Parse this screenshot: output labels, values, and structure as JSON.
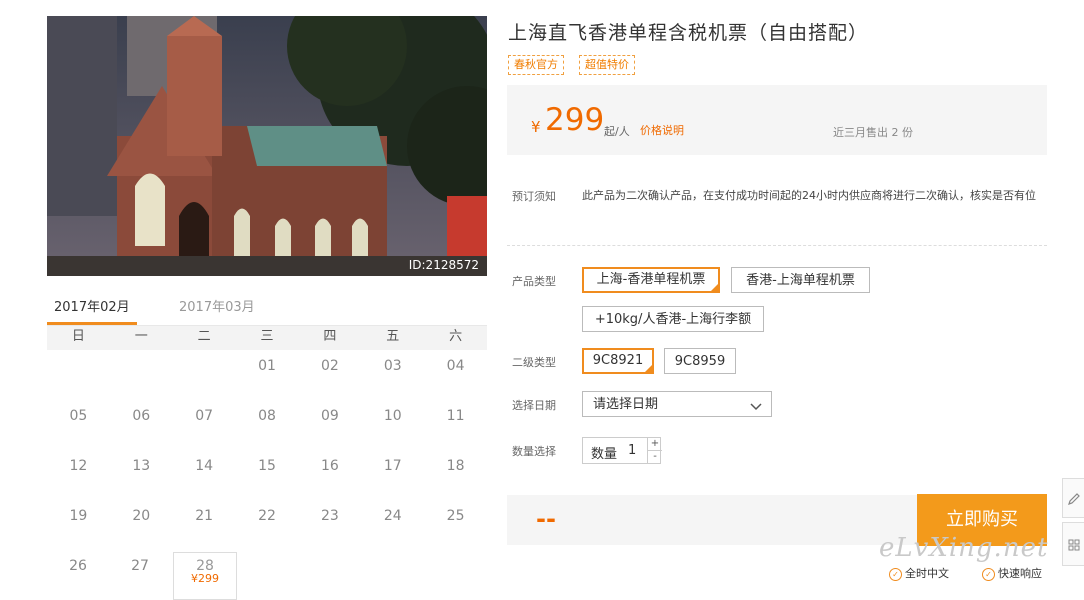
{
  "product": {
    "title": "上海直飞香港单程含税机票（自由搭配）",
    "tags": [
      "春秋官方",
      "超值特价"
    ],
    "photo_id": "ID:2128572"
  },
  "price": {
    "currency": "¥",
    "amount": "299",
    "unit": "起/人",
    "note_link": "价格说明",
    "sold": "近三月售出 2 份"
  },
  "notice": {
    "label": "预订须知",
    "text": "此产品为二次确认产品，在支付成功时间起的24小时内供应商将进行二次确认，核实是否有位"
  },
  "product_type": {
    "label": "产品类型",
    "options": [
      "上海-香港单程机票",
      "香港-上海单程机票",
      "+10kg/人香港-上海行李额"
    ],
    "selected": 0
  },
  "sub_type": {
    "label": "二级类型",
    "options": [
      "9C8921",
      "9C8959"
    ],
    "selected": 0
  },
  "date_select": {
    "label": "选择日期",
    "value": "请选择日期"
  },
  "quantity": {
    "label": "数量选择",
    "inner_label": "数量",
    "value": "1",
    "plus": "+",
    "minus": "-"
  },
  "order": {
    "total": "--",
    "buy_label": "立即购买"
  },
  "calendar": {
    "tabs": [
      "2017年02月",
      "2017年03月"
    ],
    "active_tab": 0,
    "weekdays": [
      "日",
      "一",
      "二",
      "三",
      "四",
      "五",
      "六"
    ],
    "rows": [
      [
        "",
        "",
        "",
        "01",
        "02",
        "03",
        "04"
      ],
      [
        "05",
        "06",
        "07",
        "08",
        "09",
        "10",
        "11"
      ],
      [
        "12",
        "13",
        "14",
        "15",
        "16",
        "17",
        "18"
      ],
      [
        "19",
        "20",
        "21",
        "22",
        "23",
        "24",
        "25"
      ],
      [
        "26",
        "27",
        "28",
        "",
        "",
        "",
        ""
      ]
    ],
    "priced_day": "28",
    "priced_day_price": "¥299"
  },
  "features": [
    "全时中文",
    "快速响应"
  ],
  "watermark": "eLvXing.net",
  "side_tools": [
    "edit-icon",
    "grid-icon"
  ],
  "colors": {
    "accent": "#f06a00",
    "button": "#f39a1b",
    "selected_border": "#f08c1e"
  }
}
